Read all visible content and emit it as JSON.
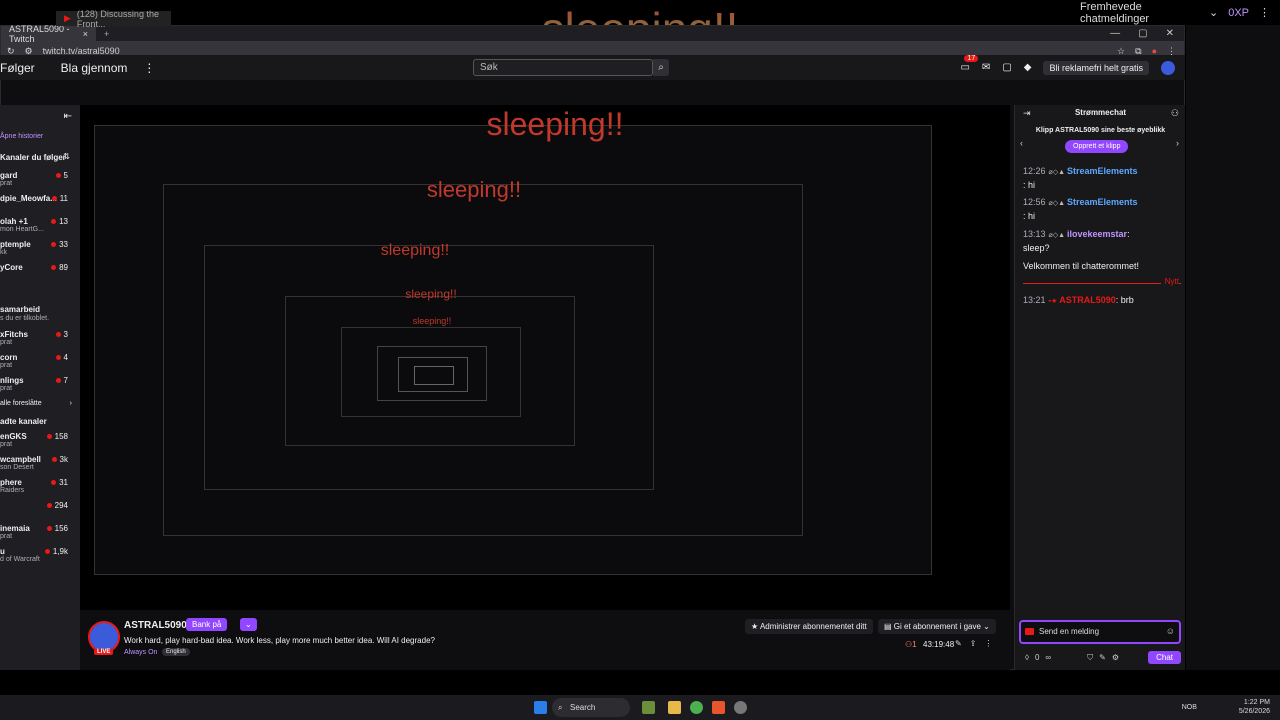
{
  "overlay": {
    "title": "sleeping!!"
  },
  "outer": {
    "featured_chat": "Fremhevede chatmeldinger",
    "xp": "0XP"
  },
  "browser": {
    "tab_background": "(128) Discussing the Front...",
    "tab_active": "ASTRAL5090 - Twitch",
    "url": "twitch.tv/astral5090"
  },
  "nav": {
    "following": "Følger",
    "browse": "Bla gjennom",
    "search_placeholder": "Søk",
    "notif_count": "17",
    "ad_free": "Bli reklamefri helt gratis"
  },
  "sidebar": {
    "open_history": "Åpne historier",
    "followed_header": "Kanaler du følger",
    "followed": [
      {
        "name": "gard",
        "sub": "prat",
        "count": "5"
      },
      {
        "name": "dpie_Meowfa...",
        "sub": "",
        "count": "11"
      },
      {
        "name": "olah +1",
        "sub": "mon HeartG...",
        "count": "13"
      },
      {
        "name": "ptemple",
        "sub": "kk",
        "count": "33"
      },
      {
        "name": "yCore",
        "sub": "",
        "count": "89"
      }
    ],
    "collab_header": "samarbeid",
    "collab_sub": "s du er tilkoblet.",
    "collab": [
      {
        "name": "xFitchs",
        "sub": "prat",
        "count": "3"
      },
      {
        "name": "corn",
        "sub": "prat",
        "count": "4"
      },
      {
        "name": "nlings",
        "sub": "prat",
        "count": "7"
      }
    ],
    "show_all": "alle foreslåtte",
    "recommended_header": "adte kanaler",
    "recommended": [
      {
        "name": "enGKS",
        "sub": "prat",
        "count": "158"
      },
      {
        "name": "wcampbell",
        "sub": "son Desert",
        "count": "3k"
      },
      {
        "name": "phere",
        "sub": "Raiders",
        "count": "31"
      },
      {
        "name": "",
        "sub": "",
        "count": "294"
      },
      {
        "name": "inemaia",
        "sub": "prat",
        "count": "156"
      },
      {
        "name": "u",
        "sub": "d of Warcraft",
        "count": "1,9k"
      }
    ]
  },
  "video": {
    "nested_titles": [
      "sleeping!!",
      "sleeping!!",
      "sleeping!!",
      "sleeping!!",
      "sleeping!!"
    ]
  },
  "channel": {
    "name": "ASTRAL5090",
    "live": "LIVE",
    "bank": "Bank på",
    "title": "Work hard, play hard-bad idea. Work less, play more much better idea. Will AI degrade?",
    "category": "Always On",
    "language": "English",
    "manage_sub": "Administrer abonnementet ditt",
    "gift_sub": "Gi et abonnement i gave",
    "viewers": "1",
    "uptime": "43:19:48"
  },
  "chat": {
    "title": "Strømmechat",
    "clip_title": "Klipp ASTRAL5090 sine beste øyeblikk",
    "clip_button": "Opprett et klipp",
    "messages": [
      {
        "time": "12:26",
        "user": "StreamElements",
        "text": ": hi"
      },
      {
        "time": "12:56",
        "user": "StreamElements",
        "text": ": hi"
      },
      {
        "time": "13:13",
        "user": "ilovekeemstar",
        "text": "sleep?"
      },
      {
        "time": "",
        "user": "",
        "text": "Velkommen til chatterommet!"
      },
      {
        "time": "13:21",
        "user": "ASTRAL5090",
        "text": ": brb"
      }
    ],
    "new_label": "Nytt",
    "input_placeholder": "Send en melding",
    "points": "0",
    "chat_button": "Chat"
  },
  "taskbar": {
    "search": "Search",
    "lang": "NOB",
    "time": "1:22 PM",
    "date": "5/26/2026"
  }
}
